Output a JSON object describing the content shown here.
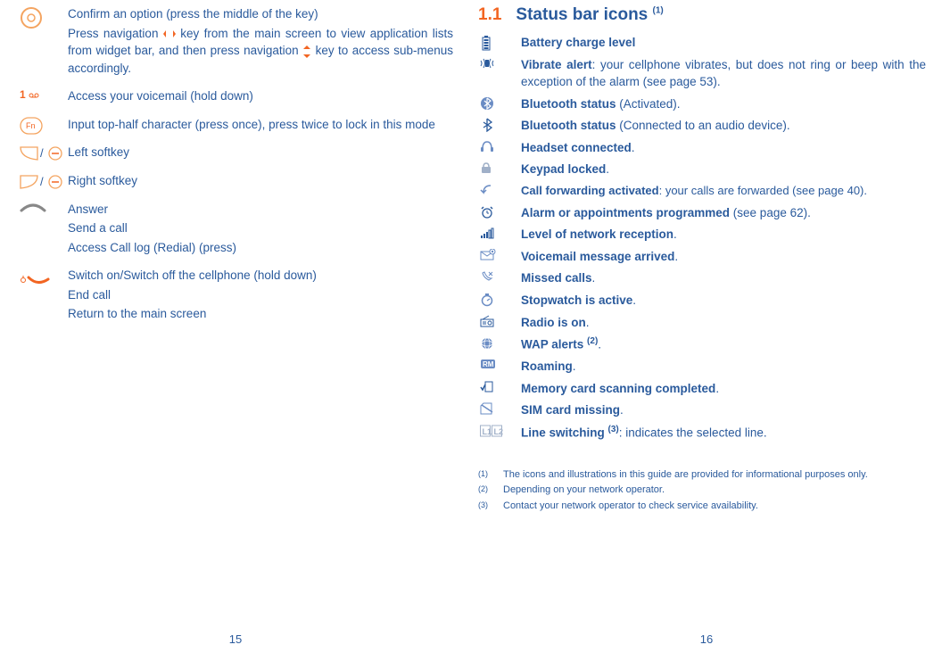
{
  "left": {
    "confirm": {
      "l1": "Confirm an option (press the middle of the key)",
      "l2a": "Press navigation ",
      "l2b": " key from the main screen to view application lists from widget bar, and then press navigation ",
      "l2c": " key to access sub-menus accordingly."
    },
    "voicemail": "Access your voicemail (hold down)",
    "fn": "Input top-half character (press once), press twice to lock in this mode",
    "leftsoft": "Left softkey",
    "rightsoft": "Right softkey",
    "answer": {
      "a": "Answer",
      "b": "Send a call",
      "c": "Access Call log (Redial) (press)"
    },
    "switch": {
      "a": "Switch on/Switch off the cellphone (hold down)",
      "b": "End call",
      "c": "Return to the main screen"
    },
    "pagenum": "15"
  },
  "right": {
    "secnum": "1.1",
    "sectitle": "Status bar icons ",
    "secfn": "(1)",
    "battery": "Battery charge level",
    "vibrate_b": "Vibrate alert",
    "vibrate_t": ": your cellphone vibrates, but does not ring or beep with the exception of the alarm (see page 53).",
    "bt_act_b": "Bluetooth status ",
    "bt_act_t": "(Activated).",
    "bt_con_b": "Bluetooth status ",
    "bt_con_t": "(Connected to an audio device).",
    "headset": "Headset connected",
    "keypad": "Keypad locked",
    "cf_b": "Call forwarding activated",
    "cf_t": ": your calls are forwarded (see page 40).",
    "alarm_b": "Alarm or appointments programmed ",
    "alarm_t": "(see page 62).",
    "network": "Level of network reception",
    "vm": "Voicemail message arrived",
    "missed": "Missed calls",
    "stopwatch": "Stopwatch is active",
    "radio": "Radio is on",
    "wap_b": "WAP alerts ",
    "wap_fn": "(2)",
    "roaming": "Roaming",
    "memcard": "Memory card scanning completed",
    "sim": "SIM card missing",
    "line_b": "Line switching ",
    "line_fn": "(3)",
    "line_t": ": indicates the selected line.",
    "fn1": "The icons and illustrations in this guide are provided for informational purposes only.",
    "fn2": "Depending on your network operator.",
    "fn3": "Contact your network operator to check service availability.",
    "fn1n": "(1)",
    "fn2n": "(2)",
    "fn3n": "(3)",
    "pagenum": "16"
  }
}
